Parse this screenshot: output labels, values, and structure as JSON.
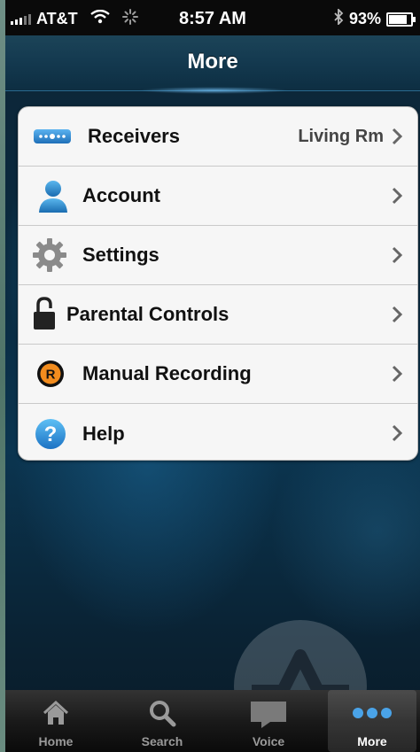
{
  "status_bar": {
    "carrier": "AT&T",
    "time": "8:57 AM",
    "battery": "93%",
    "battery_level": 0.93
  },
  "nav": {
    "title": "More"
  },
  "menu": {
    "items": [
      {
        "label": "Receivers",
        "detail": "Living Rm",
        "icon": "receiver-icon"
      },
      {
        "label": "Account",
        "icon": "account-icon"
      },
      {
        "label": "Settings",
        "icon": "gear-icon"
      },
      {
        "label": "Parental Controls",
        "icon": "lock-icon"
      },
      {
        "label": "Manual Recording",
        "icon": "record-icon"
      },
      {
        "label": "Help",
        "icon": "help-icon"
      }
    ]
  },
  "tabs": [
    {
      "label": "Home",
      "icon": "home-icon"
    },
    {
      "label": "Search",
      "icon": "search-icon"
    },
    {
      "label": "Voice",
      "icon": "voice-icon"
    },
    {
      "label": "More",
      "icon": "more-icon",
      "active": true
    }
  ],
  "colors": {
    "nav_accent": "#2a6a8f",
    "record_orange": "#f28c1e",
    "help_blue": "#2a8ad8",
    "more_dots": "#4aa3e8"
  }
}
